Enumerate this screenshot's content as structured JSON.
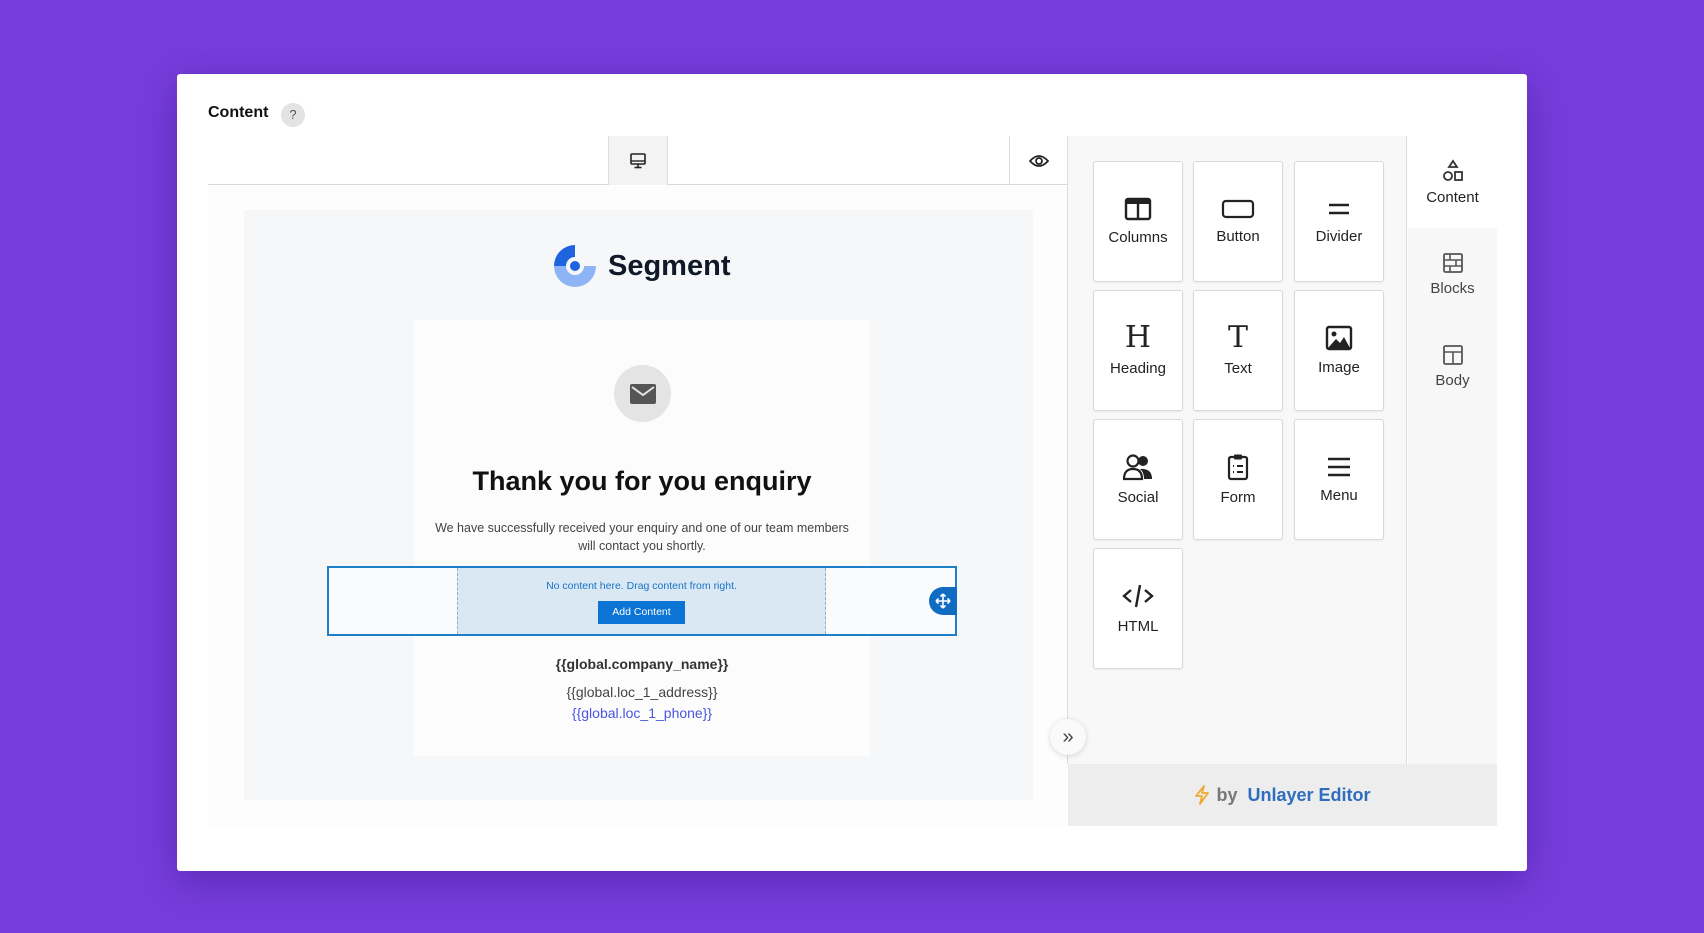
{
  "header": {
    "title": "Content",
    "help": "?"
  },
  "email": {
    "logo_text": "Segment",
    "heading": "Thank you for you enquiry",
    "body": "We have successfully received your enquiry and one of our team members will contact you shortly.",
    "empty_row": {
      "message": "No content here. Drag content from right.",
      "add_label": "Add Content"
    },
    "company": "{{global.company_name}}",
    "address": "{{global.loc_1_address}}",
    "phone": "{{global.loc_1_phone}}"
  },
  "tools": [
    {
      "label": "Columns",
      "icon": "columns-icon"
    },
    {
      "label": "Button",
      "icon": "button-icon"
    },
    {
      "label": "Divider",
      "icon": "divider-icon"
    },
    {
      "label": "Heading",
      "icon": "heading-icon"
    },
    {
      "label": "Text",
      "icon": "text-icon"
    },
    {
      "label": "Image",
      "icon": "image-icon"
    },
    {
      "label": "Social",
      "icon": "social-icon"
    },
    {
      "label": "Form",
      "icon": "form-icon"
    },
    {
      "label": "Menu",
      "icon": "menu-icon"
    },
    {
      "label": "HTML",
      "icon": "html-icon"
    }
  ],
  "tabs": [
    {
      "label": "Content",
      "active": true
    },
    {
      "label": "Blocks",
      "active": false
    },
    {
      "label": "Body",
      "active": false
    }
  ],
  "footer": {
    "by": "by",
    "brand": "Unlayer Editor"
  },
  "colors": {
    "background": "#773ddd",
    "accent": "#0b74d4",
    "brand_link": "#2f6ebd"
  }
}
